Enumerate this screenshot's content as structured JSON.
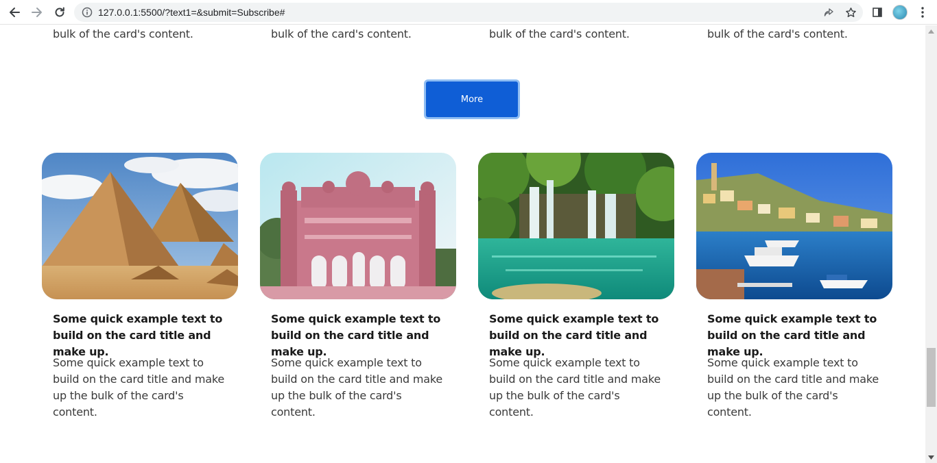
{
  "browser": {
    "url": "127.0.0.1:5500/?text1=&submit=Subscribe#",
    "back_icon": "back-arrow-icon",
    "forward_icon": "forward-arrow-icon",
    "reload_icon": "reload-icon",
    "info_icon": "site-info-icon",
    "share_icon": "share-icon",
    "bookmark_icon": "star-icon",
    "sidepanel_icon": "side-panel-icon",
    "menu_icon": "kebab-menu-icon"
  },
  "previous_row": {
    "lines": [
      "bulk of the card's content.",
      "bulk of the card's content.",
      "bulk of the card's content.",
      "bulk of the card's content."
    ]
  },
  "more_button": {
    "label": "More",
    "color": "#0f5ed6"
  },
  "cards": [
    {
      "image": "pyramids-of-giza",
      "title": "Some quick example text to build on the card title and make up.",
      "text": "Some quick example text to build on the card title and make up the bulk of the card's content."
    },
    {
      "image": "pink-palace-gate",
      "title": "Some quick example text to build on the card title and make up.",
      "text": "Some quick example text to build on the card title and make up the bulk of the card's content."
    },
    {
      "image": "waterfall-lagoon",
      "title": "Some quick example text to build on the card title and make up.",
      "text": "Some quick example text to build on the card title and make up the bulk of the card's content."
    },
    {
      "image": "harbor-town-boats",
      "title": "Some quick example text to build on the card title and make up.",
      "text": "Some quick example text to build on the card title and make up the bulk of the card's content."
    }
  ]
}
